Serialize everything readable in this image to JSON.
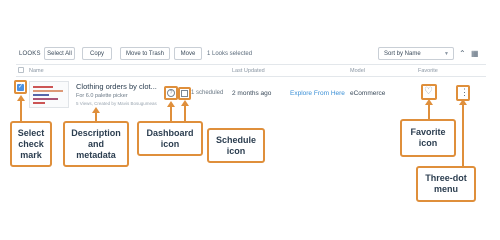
{
  "toolbar": {
    "section_title": "LOOKS",
    "select_all": "Select All",
    "copy": "Copy",
    "move_to_trash": "Move to Trash",
    "move": "Move",
    "selected_count": "1 Looks selected",
    "sort_value": "Sort by Name"
  },
  "table": {
    "headers": {
      "name": "Name",
      "last_updated": "Last Updated",
      "model": "Model",
      "favorite": "Favorite"
    },
    "row": {
      "title": "Clothing orders by clot...",
      "subtitle": "For 6.0 palette picker",
      "meta": "5 Views, Created by Mavis Bosugumeas",
      "schedule": "1 scheduled",
      "last_updated": "2 months ago",
      "explore_link": "Explore From Here",
      "model": "eCommerce"
    }
  },
  "annotations": {
    "select_check": "Select\ncheck\nmark",
    "description": "Description\nand\nmetadata",
    "dashboard": "Dashboard\nicon",
    "schedule": "Schedule\nicon",
    "favorite": "Favorite\nicon",
    "three_dot": "Three-dot\nmenu"
  },
  "colors": {
    "accent": "#df8f3b",
    "link": "#3a8fd6",
    "check": "#4a90e2"
  }
}
